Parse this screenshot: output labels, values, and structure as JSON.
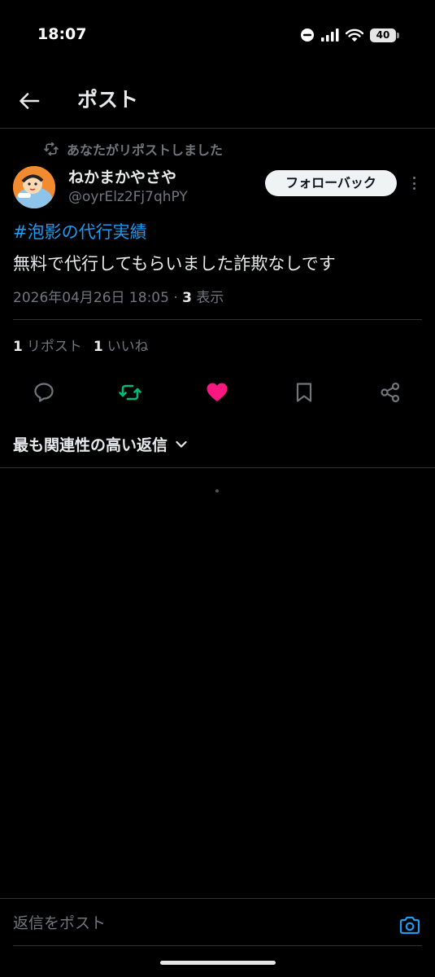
{
  "status_bar": {
    "time": "18:07",
    "battery": "40",
    "icons": [
      "dnd-icon",
      "signal-icon",
      "wifi-icon",
      "battery-icon"
    ]
  },
  "header": {
    "title": "ポスト",
    "back_icon": "arrow-left-icon"
  },
  "post": {
    "repost_label": "あなたがリポストしました",
    "author_name": "ねかまかやさや",
    "author_handle": "@oyrElz2Fj7qhPY",
    "follow_button": "フォローバック",
    "hashtag": "#泡影の代行実績",
    "body": "無料で代行してもらいました詐欺なしです",
    "timestamp": "2026年04月26日 18:05",
    "separator": "·",
    "views_count": "3",
    "views_label": "表示",
    "repost_count": "1",
    "repost_count_label": "リポスト",
    "like_count": "1",
    "like_count_label": "いいね"
  },
  "actions": {
    "icons": [
      "reply-icon",
      "repost-icon",
      "like-icon",
      "bookmark-icon",
      "share-icon"
    ],
    "repost_active_color": "#00ba7c",
    "like_active_color": "#f91880"
  },
  "replies": {
    "sort_label": "最も関連性の高い返信"
  },
  "reply_bar": {
    "placeholder": "返信をポスト",
    "camera_color": "#1d9bf0"
  },
  "colors": {
    "background": "#000000",
    "text_primary": "#e7e9ea",
    "text_secondary": "#71767b",
    "link": "#1d9bf0",
    "divider": "#2f3336"
  }
}
